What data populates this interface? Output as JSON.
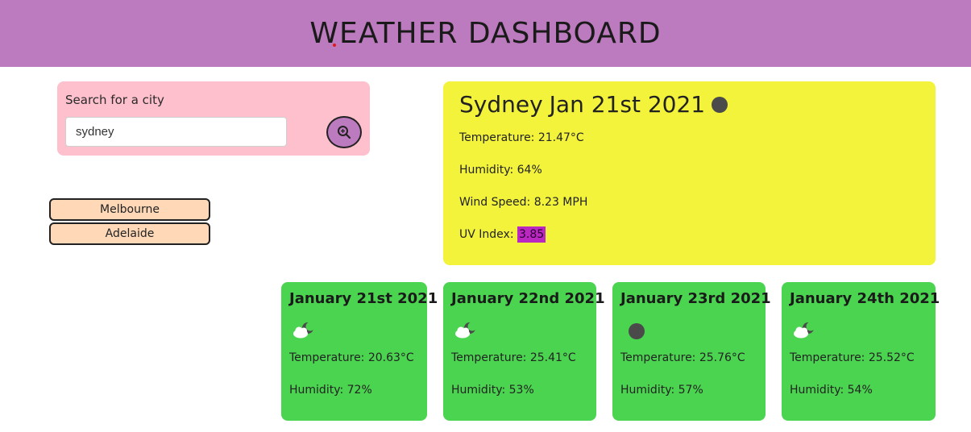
{
  "header": {
    "title": "WEATHER DASHBOARD"
  },
  "search": {
    "label": "Search for a city",
    "value": "sydney",
    "button_icon": "search-icon"
  },
  "history": {
    "cities": [
      "Melbourne",
      "Adelaide"
    ]
  },
  "current": {
    "city": "Sydney",
    "date": "Jan 21st 2021",
    "icon": "moon-icon",
    "temperature": "Temperature: 21.47°C",
    "humidity": "Humidity: 64%",
    "wind": "Wind Speed: 8.23 MPH",
    "uv_label": "UV Index:",
    "uv_value": "3.85",
    "uv_color": "#bb27c1"
  },
  "forecast": [
    {
      "date": "January 21st 2021",
      "icon": "partly-cloudy-night-icon",
      "temperature": "Temperature: 20.63°C",
      "humidity": "Humidity: 72%"
    },
    {
      "date": "January 22nd 2021",
      "icon": "partly-cloudy-night-icon",
      "temperature": "Temperature: 25.41°C",
      "humidity": "Humidity: 53%"
    },
    {
      "date": "January 23rd 2021",
      "icon": "moon-icon",
      "temperature": "Temperature: 25.76°C",
      "humidity": "Humidity: 57%"
    },
    {
      "date": "January 24th 2021",
      "icon": "partly-cloudy-night-icon",
      "temperature": "Temperature: 25.52°C",
      "humidity": "Humidity: 54%"
    }
  ],
  "colors": {
    "header": "#bd7bbf",
    "search_panel": "#fec0cc",
    "current_panel": "#f3f33b",
    "forecast_card": "#4bd450",
    "city_button": "#ffd8b8"
  }
}
